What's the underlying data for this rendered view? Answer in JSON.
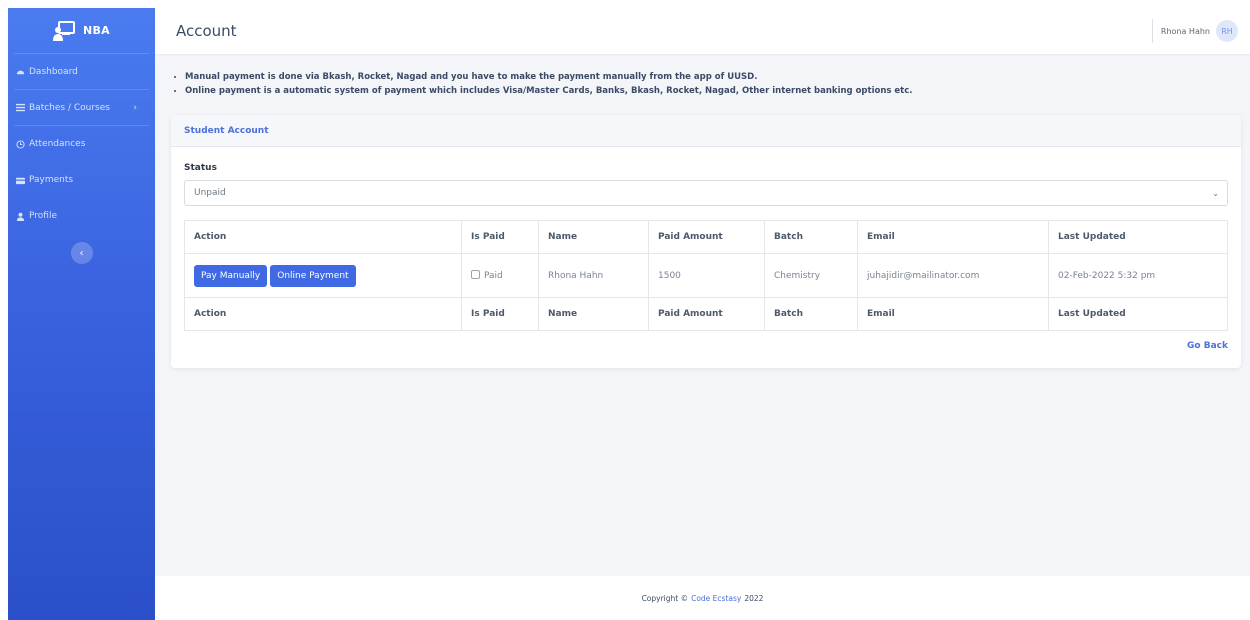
{
  "brand": {
    "name": "NBA"
  },
  "sidebar": {
    "items": [
      {
        "label": "Dashboard",
        "icon": "dashboard-icon"
      },
      {
        "label": "Batches / Courses",
        "icon": "list-icon"
      },
      {
        "label": "Attendances",
        "icon": "clock-icon"
      },
      {
        "label": "Payments",
        "icon": "card-icon"
      },
      {
        "label": "Profile",
        "icon": "user-icon"
      }
    ],
    "collapse_glyph": "‹"
  },
  "header": {
    "title": "Account",
    "user_name": "Rhona Hahn",
    "user_initials": "RH"
  },
  "notes": [
    "Manual payment is done via Bkash, Rocket, Nagad and you have to make the payment manually from the app of UUSD.",
    "Online payment is a automatic system of payment which includes Visa/Master Cards, Banks, Bkash, Rocket, Nagad, Other internet banking options etc."
  ],
  "card": {
    "title": "Student Account",
    "status_label": "Status",
    "status_value": "Unpaid",
    "go_back": "Go Back"
  },
  "table": {
    "columns": [
      "Action",
      "Is Paid",
      "Name",
      "Paid Amount",
      "Batch",
      "Email",
      "Last Updated"
    ],
    "row": {
      "pay_manually": "Pay Manually",
      "online_payment": "Online Payment",
      "is_paid": "Paid",
      "name": "Rhona Hahn",
      "paid_amount": "1500",
      "batch": "Chemistry",
      "email": "juhajidir@mailinator.com",
      "last_updated": "02-Feb-2022 5:32 pm"
    }
  },
  "footer": {
    "prefix": "Copyright ©",
    "link": "Code Ecstasy",
    "suffix": "2022"
  },
  "colors": {
    "primary": "#3f6ae3",
    "sidebar_top": "#4a7cf0",
    "sidebar_bottom": "#2a4fc9"
  }
}
